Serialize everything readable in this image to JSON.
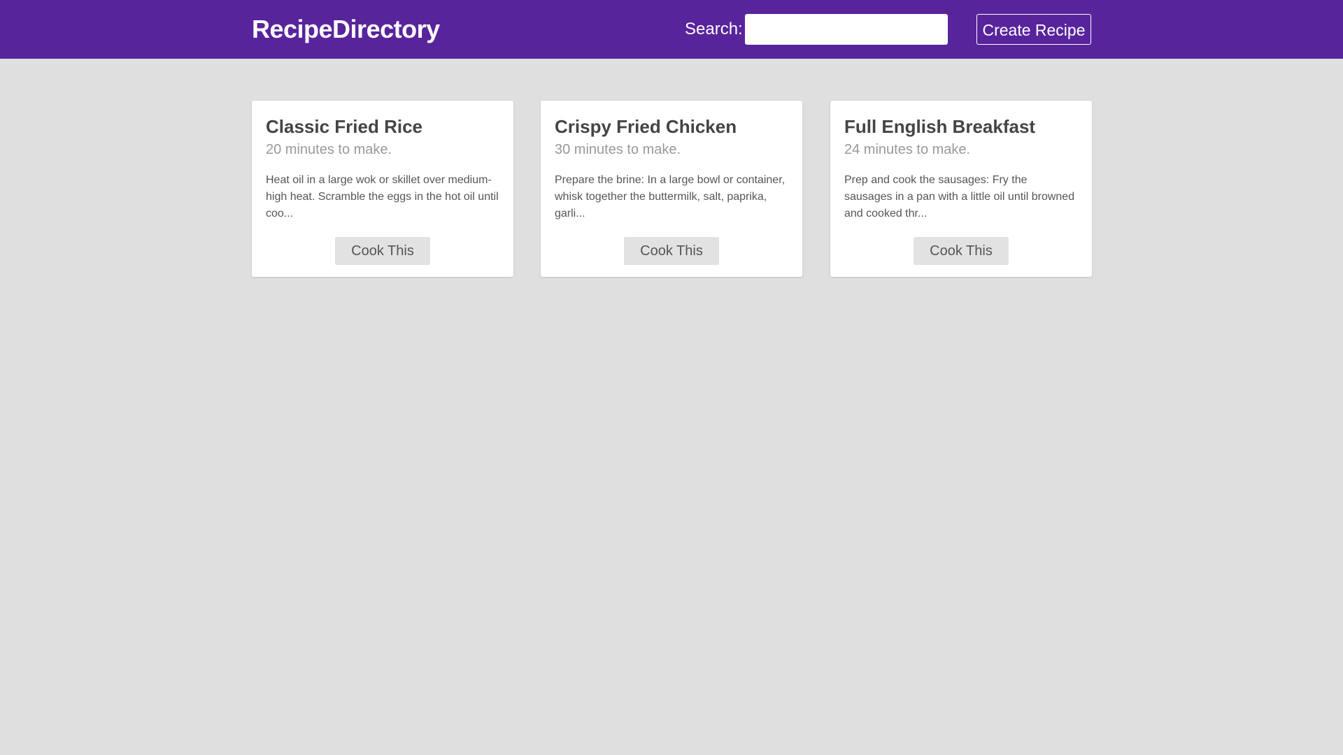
{
  "navbar": {
    "brand": "RecipeDirectory",
    "search_label": "Search:",
    "search_value": "",
    "create_label": "Create Recipe",
    "background_color": "#58249c"
  },
  "recipes": [
    {
      "title": "Classic Fried Rice",
      "time": "20 minutes to make.",
      "method": "Heat oil in a large wok or skillet over medium-high heat. Scramble the eggs in the hot oil until coo...",
      "button_label": "Cook This"
    },
    {
      "title": "Crispy Fried Chicken",
      "time": "30 minutes to make.",
      "method": "Prepare the brine: In a large bowl or container, whisk together the buttermilk, salt, paprika, garli...",
      "button_label": "Cook This"
    },
    {
      "title": "Full English Breakfast",
      "time": "24 minutes to make.",
      "method": "Prep and cook the sausages: Fry the sausages in a pan with a little oil until browned and cooked thr...",
      "button_label": "Cook This"
    }
  ]
}
